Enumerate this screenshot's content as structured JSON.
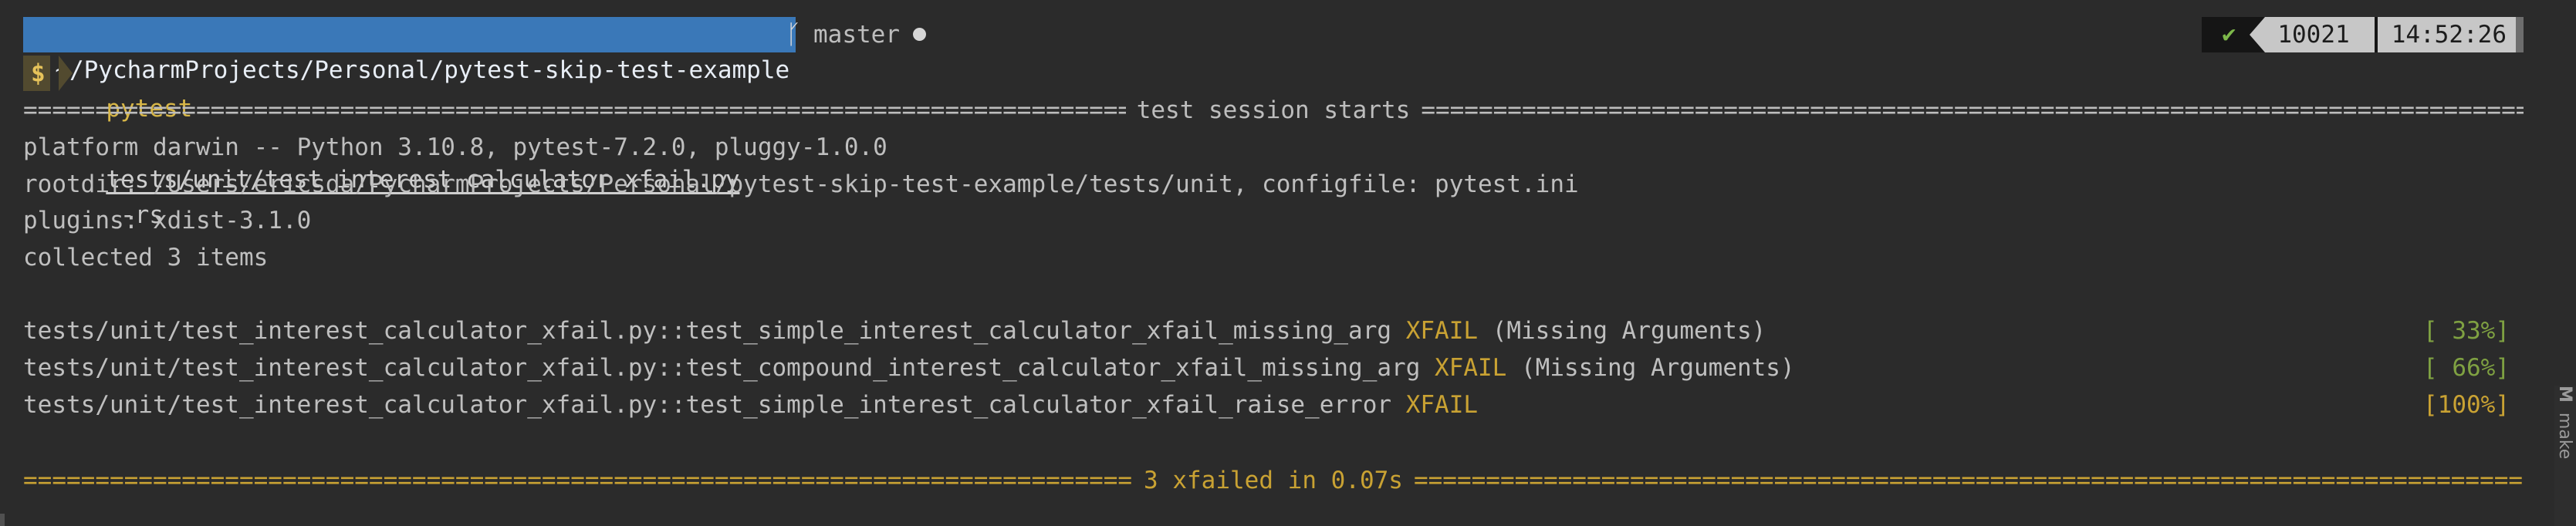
{
  "prompt": {
    "path": "~/PycharmProjects/Personal/pytest-skip-test-example",
    "branch_icon": "git-branch-icon",
    "branch_glyph": "ᚴ",
    "branch": "master",
    "dirty_indicator": "dirty-dot-icon",
    "status_check": "✔",
    "history_number": "10021",
    "time": "14:52:26",
    "dollar": "$"
  },
  "command": {
    "name": "pytest",
    "file": "tests/unit/test_interest_calculator_xfail.py",
    "args": " -rs"
  },
  "output": {
    "session_header": "test session starts",
    "platform": "platform darwin -- Python 3.10.8, pytest-7.2.0, pluggy-1.0.0",
    "rootdir": "rootdir: /Users/ericsda/PycharmProjects/Personal/pytest-skip-test-example/tests/unit, configfile: pytest.ini",
    "plugins": "plugins: xdist-3.1.0",
    "collected": "collected 3 items",
    "results": [
      {
        "test": "tests/unit/test_interest_calculator_xfail.py::test_simple_interest_calculator_xfail_missing_arg ",
        "status": "XFAIL",
        "reason": " (Missing Arguments)",
        "progress": "[ 33%]"
      },
      {
        "test": "tests/unit/test_interest_calculator_xfail.py::test_compound_interest_calculator_xfail_missing_arg ",
        "status": "XFAIL",
        "reason": " (Missing Arguments)",
        "progress": "[ 66%]"
      },
      {
        "test": "tests/unit/test_interest_calculator_xfail.py::test_simple_interest_calculator_xfail_raise_error ",
        "status": "XFAIL",
        "reason": "",
        "progress": "[100%]"
      }
    ],
    "summary": "3 xfailed in 0.07s"
  },
  "side_panel": {
    "label": "make"
  },
  "colors": {
    "background": "#2b2b2b",
    "path_segment": "#3a78b8",
    "xfail_yellow": "#c9a233",
    "progress_green": "#7fa142",
    "status_check_green": "#7db84a"
  }
}
